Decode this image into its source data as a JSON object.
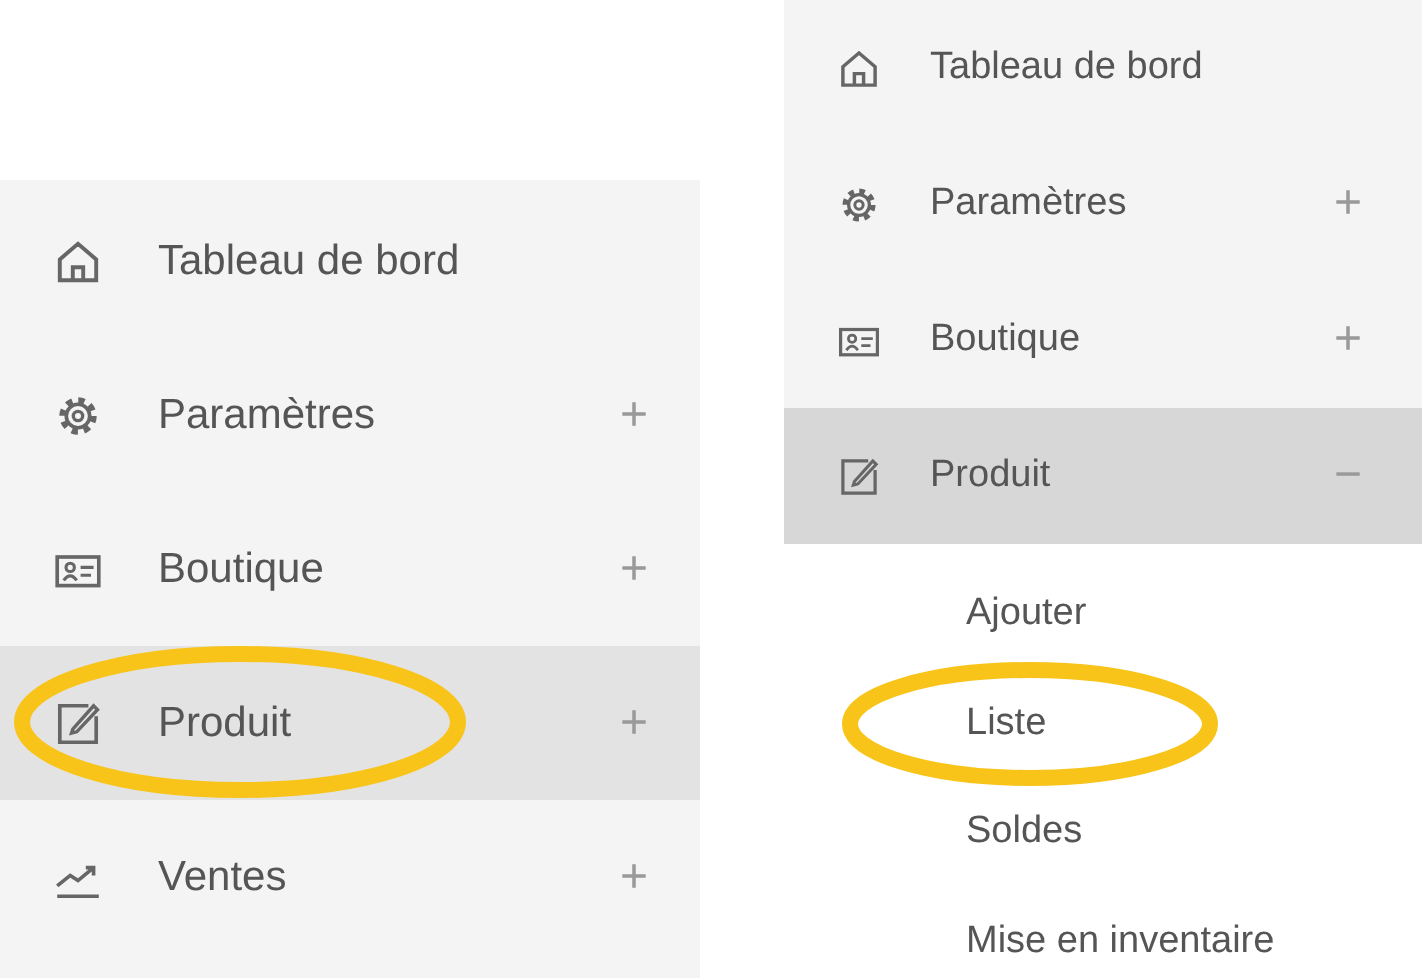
{
  "left_menu": {
    "items": [
      {
        "label": "Tableau de bord",
        "kind": "home",
        "selected": false,
        "circled": false
      },
      {
        "label": "Paramètres",
        "kind": "gear",
        "toggle": "+",
        "selected": false,
        "circled": false
      },
      {
        "label": "Boutique",
        "kind": "card",
        "toggle": "+",
        "selected": false,
        "circled": false
      },
      {
        "label": "Produit",
        "kind": "edit",
        "toggle": "+",
        "selected": true,
        "circled": true
      },
      {
        "label": "Ventes",
        "kind": "chart",
        "toggle": "+",
        "selected": false,
        "circled": false
      }
    ]
  },
  "right_menu": {
    "items": [
      {
        "label": "Tableau de bord",
        "kind": "home",
        "selected": false
      },
      {
        "label": "Paramètres",
        "kind": "gear",
        "toggle": "+",
        "selected": false
      },
      {
        "label": "Boutique",
        "kind": "card",
        "toggle": "+",
        "selected": false
      },
      {
        "label": "Produit",
        "kind": "edit",
        "toggle": "−",
        "selected": true,
        "children": [
          {
            "label": "Ajouter",
            "circled": false
          },
          {
            "label": "Liste",
            "circled": true
          },
          {
            "label": "Soldes",
            "circled": false
          },
          {
            "label": "Mise en inventaire",
            "circled": false
          }
        ]
      }
    ]
  }
}
